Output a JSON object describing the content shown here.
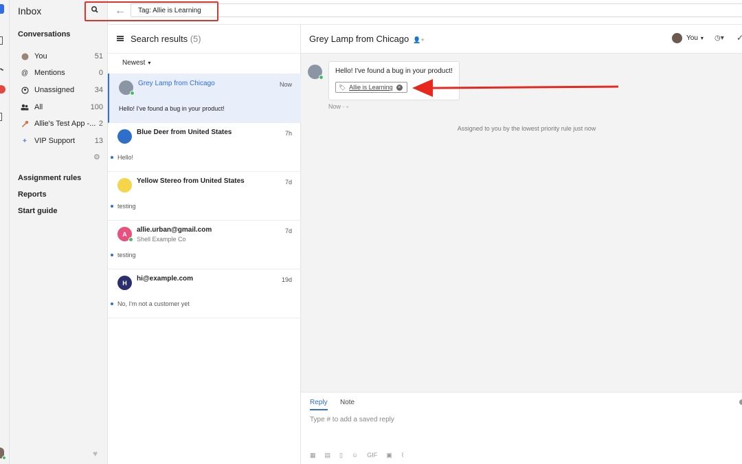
{
  "app": {
    "title": "Inbox"
  },
  "search": {
    "value": "Tag: Allie is Learning"
  },
  "nav": {
    "section": "Conversations",
    "items": [
      {
        "label": "You",
        "count": "51",
        "icon": "avatar-icon"
      },
      {
        "label": "Mentions",
        "count": "0",
        "icon": "at-icon"
      },
      {
        "label": "Unassigned",
        "count": "34",
        "icon": "unassigned-icon"
      },
      {
        "label": "All",
        "count": "100",
        "icon": "people-icon"
      },
      {
        "label": "Allie's Test App -...",
        "count": "2",
        "icon": "key-icon"
      },
      {
        "label": "VIP Support",
        "count": "13",
        "icon": "sparkle-icon"
      }
    ],
    "links": [
      "Assignment rules",
      "Reports",
      "Start guide"
    ]
  },
  "list": {
    "title": "Search results",
    "count": "(5)",
    "sort": "Newest",
    "conversations": [
      {
        "name": "Grey Lamp from Chicago",
        "sub": "",
        "time": "Now",
        "preview": "Hello! I've found a bug in your product!",
        "avatar": "",
        "avatar_color": "#8a96a3"
      },
      {
        "name": "Blue Deer from United States",
        "sub": "",
        "time": "7h",
        "preview": "Hello!",
        "avatar": "",
        "avatar_color": "#2f6fc9"
      },
      {
        "name": "Yellow Stereo from United States",
        "sub": "",
        "time": "7d",
        "preview": "testing",
        "avatar": "",
        "avatar_color": "#f5d54a"
      },
      {
        "name": "allie.urban@gmail.com",
        "sub": "Shell Example Co",
        "time": "7d",
        "preview": "testing",
        "avatar": "A",
        "avatar_color": "#e8517d"
      },
      {
        "name": "hi@example.com",
        "sub": "",
        "time": "19d",
        "preview": "No, I'm not a customer yet",
        "avatar": "H",
        "avatar_color": "#2b2f6e"
      }
    ]
  },
  "detail": {
    "title": "Grey Lamp from Chicago",
    "assignee": "You",
    "message": "Hello! I've found a bug in your product!",
    "tag": "Allie is Learning",
    "meta": "Now ·",
    "assigned_note": "Assigned to you by the lowest priority rule just now"
  },
  "reply": {
    "tab_reply": "Reply",
    "tab_note": "Note",
    "placeholder": "Type # to add a saved reply",
    "gif": "GIF"
  },
  "colors": {
    "accent": "#2f6de1",
    "annotation": "#e0342b"
  }
}
